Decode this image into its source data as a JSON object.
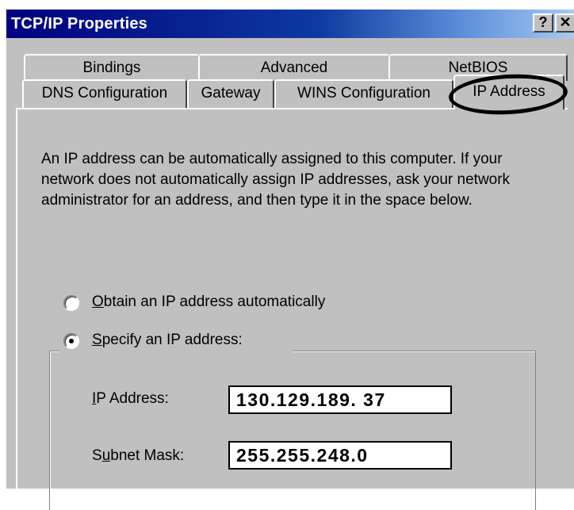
{
  "window": {
    "title": "TCP/IP Properties",
    "help_label": "?",
    "close_label": "✕"
  },
  "tabs": {
    "row1": [
      "Bindings",
      "Advanced",
      "NetBIOS"
    ],
    "row2": [
      "DNS Configuration",
      "Gateway",
      "WINS Configuration",
      "IP Address"
    ],
    "active": "IP Address"
  },
  "description": "An IP address can be automatically assigned to this computer. If your network does not automatically assign IP addresses, ask your network administrator for an address, and then type it in the space below.",
  "options": {
    "obtain": {
      "mnemonic": "O",
      "rest": "btain an IP address automatically",
      "selected": false
    },
    "specify": {
      "mnemonic": "S",
      "rest": "pecify an IP address:",
      "selected": true
    }
  },
  "fields": {
    "ip_address": {
      "label_mnemonic": "I",
      "label_rest": "P Address:",
      "value": "130.129.189. 37"
    },
    "subnet_mask": {
      "label_pre": "S",
      "label_mnemonic": "u",
      "label_rest": "bnet Mask:",
      "value": "255.255.248.0"
    }
  },
  "colors": {
    "title_start": "#000080",
    "title_end": "#a6caf0",
    "dialog_face": "#c0c0c0"
  }
}
